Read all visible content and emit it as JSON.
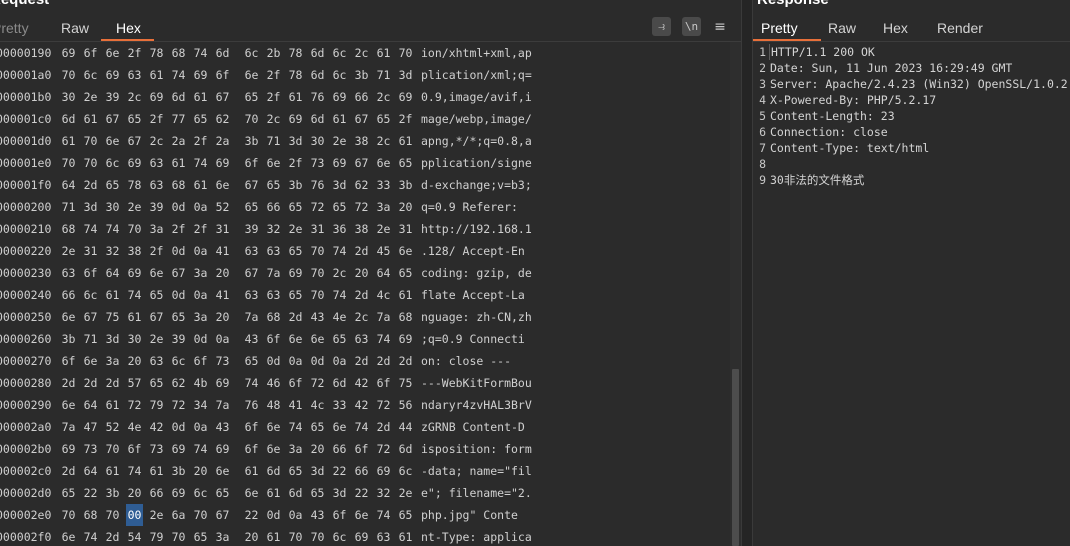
{
  "request": {
    "title": "Request",
    "tabs": [
      "Pretty",
      "Raw",
      "Hex"
    ],
    "active_tab": "Hex",
    "tools": {
      "wrap_icon": "⥽",
      "newline_icon": "\\n",
      "menu_icon": "≡"
    },
    "rows": [
      {
        "offset": "00000190",
        "bytes": [
          "69",
          "6f",
          "6e",
          "2f",
          "78",
          "68",
          "74",
          "6d",
          "6c",
          "2b",
          "78",
          "6d",
          "6c",
          "2c",
          "61",
          "70"
        ],
        "ascii": "ion/xhtml+xml,ap"
      },
      {
        "offset": "000001a0",
        "bytes": [
          "70",
          "6c",
          "69",
          "63",
          "61",
          "74",
          "69",
          "6f",
          "6e",
          "2f",
          "78",
          "6d",
          "6c",
          "3b",
          "71",
          "3d"
        ],
        "ascii": "plication/xml;q="
      },
      {
        "offset": "000001b0",
        "bytes": [
          "30",
          "2e",
          "39",
          "2c",
          "69",
          "6d",
          "61",
          "67",
          "65",
          "2f",
          "61",
          "76",
          "69",
          "66",
          "2c",
          "69"
        ],
        "ascii": "0.9,image/avif,i"
      },
      {
        "offset": "000001c0",
        "bytes": [
          "6d",
          "61",
          "67",
          "65",
          "2f",
          "77",
          "65",
          "62",
          "70",
          "2c",
          "69",
          "6d",
          "61",
          "67",
          "65",
          "2f"
        ],
        "ascii": "mage/webp,image/"
      },
      {
        "offset": "000001d0",
        "bytes": [
          "61",
          "70",
          "6e",
          "67",
          "2c",
          "2a",
          "2f",
          "2a",
          "3b",
          "71",
          "3d",
          "30",
          "2e",
          "38",
          "2c",
          "61"
        ],
        "ascii": "apng,*/*;q=0.8,a"
      },
      {
        "offset": "000001e0",
        "bytes": [
          "70",
          "70",
          "6c",
          "69",
          "63",
          "61",
          "74",
          "69",
          "6f",
          "6e",
          "2f",
          "73",
          "69",
          "67",
          "6e",
          "65"
        ],
        "ascii": "pplication/signe"
      },
      {
        "offset": "000001f0",
        "bytes": [
          "64",
          "2d",
          "65",
          "78",
          "63",
          "68",
          "61",
          "6e",
          "67",
          "65",
          "3b",
          "76",
          "3d",
          "62",
          "33",
          "3b"
        ],
        "ascii": "d-exchange;v=b3;"
      },
      {
        "offset": "00000200",
        "bytes": [
          "71",
          "3d",
          "30",
          "2e",
          "39",
          "0d",
          "0a",
          "52",
          "65",
          "66",
          "65",
          "72",
          "65",
          "72",
          "3a",
          "20"
        ],
        "ascii": "q=0.9 Referer: "
      },
      {
        "offset": "00000210",
        "bytes": [
          "68",
          "74",
          "74",
          "70",
          "3a",
          "2f",
          "2f",
          "31",
          "39",
          "32",
          "2e",
          "31",
          "36",
          "38",
          "2e",
          "31"
        ],
        "ascii": "http://192.168.1"
      },
      {
        "offset": "00000220",
        "bytes": [
          "2e",
          "31",
          "32",
          "38",
          "2f",
          "0d",
          "0a",
          "41",
          "63",
          "63",
          "65",
          "70",
          "74",
          "2d",
          "45",
          "6e"
        ],
        "ascii": ".128/ Accept-En"
      },
      {
        "offset": "00000230",
        "bytes": [
          "63",
          "6f",
          "64",
          "69",
          "6e",
          "67",
          "3a",
          "20",
          "67",
          "7a",
          "69",
          "70",
          "2c",
          "20",
          "64",
          "65"
        ],
        "ascii": "coding: gzip, de"
      },
      {
        "offset": "00000240",
        "bytes": [
          "66",
          "6c",
          "61",
          "74",
          "65",
          "0d",
          "0a",
          "41",
          "63",
          "63",
          "65",
          "70",
          "74",
          "2d",
          "4c",
          "61"
        ],
        "ascii": "flate Accept-La"
      },
      {
        "offset": "00000250",
        "bytes": [
          "6e",
          "67",
          "75",
          "61",
          "67",
          "65",
          "3a",
          "20",
          "7a",
          "68",
          "2d",
          "43",
          "4e",
          "2c",
          "7a",
          "68"
        ],
        "ascii": "nguage: zh-CN,zh"
      },
      {
        "offset": "00000260",
        "bytes": [
          "3b",
          "71",
          "3d",
          "30",
          "2e",
          "39",
          "0d",
          "0a",
          "43",
          "6f",
          "6e",
          "6e",
          "65",
          "63",
          "74",
          "69"
        ],
        "ascii": ";q=0.9 Connecti"
      },
      {
        "offset": "00000270",
        "bytes": [
          "6f",
          "6e",
          "3a",
          "20",
          "63",
          "6c",
          "6f",
          "73",
          "65",
          "0d",
          "0a",
          "0d",
          "0a",
          "2d",
          "2d",
          "2d"
        ],
        "ascii": "on: close  ---"
      },
      {
        "offset": "00000280",
        "bytes": [
          "2d",
          "2d",
          "2d",
          "57",
          "65",
          "62",
          "4b",
          "69",
          "74",
          "46",
          "6f",
          "72",
          "6d",
          "42",
          "6f",
          "75"
        ],
        "ascii": "---WebKitFormBou"
      },
      {
        "offset": "00000290",
        "bytes": [
          "6e",
          "64",
          "61",
          "72",
          "79",
          "72",
          "34",
          "7a",
          "76",
          "48",
          "41",
          "4c",
          "33",
          "42",
          "72",
          "56"
        ],
        "ascii": "ndaryr4zvHAL3BrV"
      },
      {
        "offset": "000002a0",
        "bytes": [
          "7a",
          "47",
          "52",
          "4e",
          "42",
          "0d",
          "0a",
          "43",
          "6f",
          "6e",
          "74",
          "65",
          "6e",
          "74",
          "2d",
          "44"
        ],
        "ascii": "zGRNB Content-D"
      },
      {
        "offset": "000002b0",
        "bytes": [
          "69",
          "73",
          "70",
          "6f",
          "73",
          "69",
          "74",
          "69",
          "6f",
          "6e",
          "3a",
          "20",
          "66",
          "6f",
          "72",
          "6d"
        ],
        "ascii": "isposition: form"
      },
      {
        "offset": "000002c0",
        "bytes": [
          "2d",
          "64",
          "61",
          "74",
          "61",
          "3b",
          "20",
          "6e",
          "61",
          "6d",
          "65",
          "3d",
          "22",
          "66",
          "69",
          "6c"
        ],
        "ascii": "-data; name=\"fil"
      },
      {
        "offset": "000002d0",
        "bytes": [
          "65",
          "22",
          "3b",
          "20",
          "66",
          "69",
          "6c",
          "65",
          "6e",
          "61",
          "6d",
          "65",
          "3d",
          "22",
          "32",
          "2e"
        ],
        "ascii": "e\"; filename=\"2."
      },
      {
        "offset": "000002e0",
        "bytes": [
          "70",
          "68",
          "70",
          "00",
          "2e",
          "6a",
          "70",
          "67",
          "22",
          "0d",
          "0a",
          "43",
          "6f",
          "6e",
          "74",
          "65"
        ],
        "ascii": "php.jpg\" Conte"
      },
      {
        "offset": "000002f0",
        "bytes": [
          "6e",
          "74",
          "2d",
          "54",
          "79",
          "70",
          "65",
          "3a",
          "20",
          "61",
          "70",
          "70",
          "6c",
          "69",
          "63",
          "61"
        ],
        "ascii": "nt-Type: applica"
      }
    ],
    "selected": {
      "row": 21,
      "byte": 3
    }
  },
  "response": {
    "title": "Response",
    "tabs": [
      "Pretty",
      "Raw",
      "Hex",
      "Render"
    ],
    "active_tab": "Pretty",
    "lines": [
      {
        "n": "1",
        "text": "HTTP/1.1 200 OK"
      },
      {
        "n": "2",
        "text": "Date: Sun, 11 Jun 2023 16:29:49 GMT"
      },
      {
        "n": "3",
        "text": "Server: Apache/2.4.23 (Win32) OpenSSL/1.0.2"
      },
      {
        "n": "4",
        "text": "X-Powered-By: PHP/5.2.17"
      },
      {
        "n": "5",
        "text": "Content-Length: 23"
      },
      {
        "n": "6",
        "text": "Connection: close"
      },
      {
        "n": "7",
        "text": "Content-Type: text/html"
      },
      {
        "n": "8",
        "text": ""
      },
      {
        "n": "9",
        "text": "30非法的文件格式"
      }
    ]
  },
  "colors": {
    "background": "#2b2b2b",
    "accent": "#e8703a",
    "selection": "#2f5d94"
  }
}
